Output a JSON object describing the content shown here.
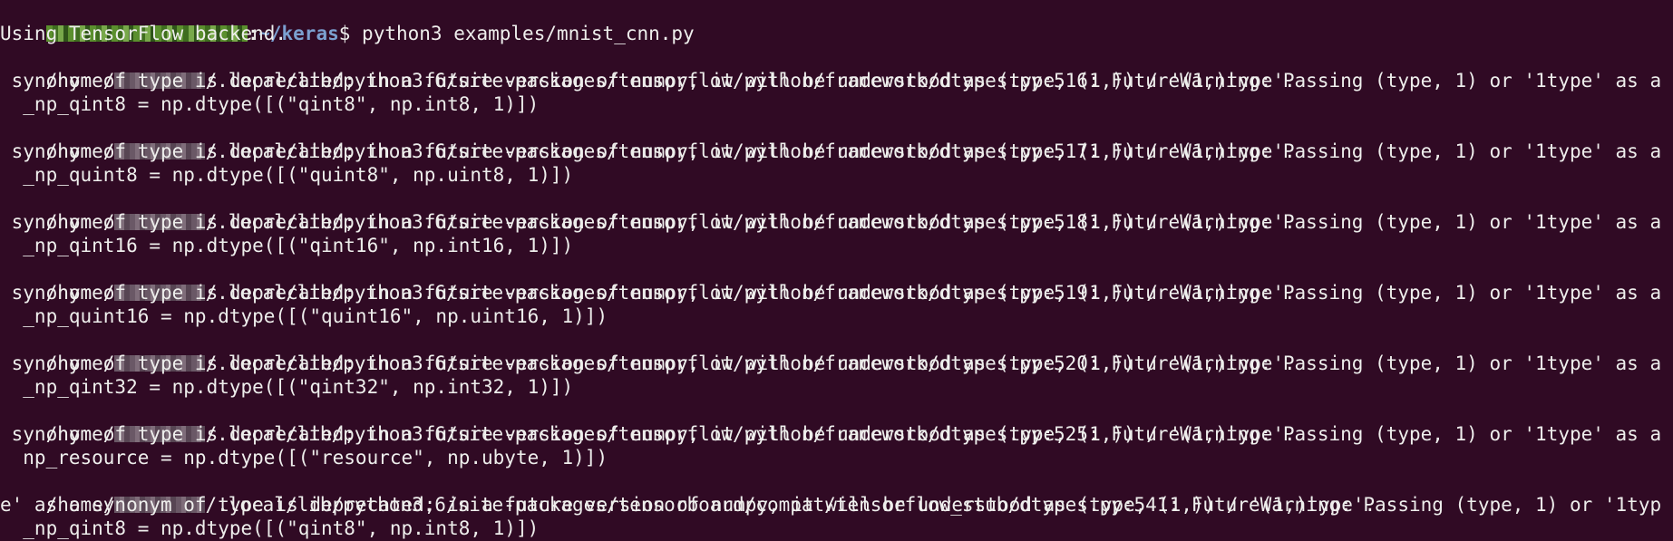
{
  "terminal": {
    "prompt": {
      "user_host_redacted": "user@host",
      "path": "~/keras",
      "symbol": "$",
      "command": " python3 examples/mnist_cnn.py"
    },
    "lines": [
      {
        "text": "Using TensorFlow backend."
      },
      {
        "home": "/home/",
        "rest": "/.local/lib/python3.6/site-packages/tensorflow/python/framework/dtypes.py:516: FutureWarning: Passing (type, 1) or '1type' as a"
      },
      {
        "text": " synonym of type is deprecated; in a future version of numpy, it will be understood as (type, (1,)) / '(1,)type'."
      },
      {
        "text": "  _np_qint8 = np.dtype([(\"qint8\", np.int8, 1)])"
      },
      {
        "home": "/home/",
        "rest": "/.local/lib/python3.6/site-packages/tensorflow/python/framework/dtypes.py:517: FutureWarning: Passing (type, 1) or '1type' as a"
      },
      {
        "text": " synonym of type is deprecated; in a future version of numpy, it will be understood as (type, (1,)) / '(1,)type'."
      },
      {
        "text": "  _np_quint8 = np.dtype([(\"quint8\", np.uint8, 1)])"
      },
      {
        "home": "/home/",
        "rest": "/.local/lib/python3.6/site-packages/tensorflow/python/framework/dtypes.py:518: FutureWarning: Passing (type, 1) or '1type' as a"
      },
      {
        "text": " synonym of type is deprecated; in a future version of numpy, it will be understood as (type, (1,)) / '(1,)type'."
      },
      {
        "text": "  _np_qint16 = np.dtype([(\"qint16\", np.int16, 1)])"
      },
      {
        "home": "/home/",
        "rest": "/.local/lib/python3.6/site-packages/tensorflow/python/framework/dtypes.py:519: FutureWarning: Passing (type, 1) or '1type' as a"
      },
      {
        "text": " synonym of type is deprecated; in a future version of numpy, it will be understood as (type, (1,)) / '(1,)type'."
      },
      {
        "text": "  _np_quint16 = np.dtype([(\"quint16\", np.uint16, 1)])"
      },
      {
        "home": "/home/",
        "rest": "/.local/lib/python3.6/site-packages/tensorflow/python/framework/dtypes.py:520: FutureWarning: Passing (type, 1) or '1type' as a"
      },
      {
        "text": " synonym of type is deprecated; in a future version of numpy, it will be understood as (type, (1,)) / '(1,)type'."
      },
      {
        "text": "  _np_qint32 = np.dtype([(\"qint32\", np.int32, 1)])"
      },
      {
        "home": "/home/",
        "rest": "/.local/lib/python3.6/site-packages/tensorflow/python/framework/dtypes.py:525: FutureWarning: Passing (type, 1) or '1type' as a"
      },
      {
        "text": " synonym of type is deprecated; in a future version of numpy, it will be understood as (type, (1,)) / '(1,)type'."
      },
      {
        "text": "  np_resource = np.dtype([(\"resource\", np.ubyte, 1)])"
      },
      {
        "home": "/home/",
        "rest": "/.local/lib/python3.6/site-packages/tensorboard/compat/tensorflow_stub/dtypes.py:541: FutureWarning: Passing (type, 1) or '1typ"
      },
      {
        "text": "e' as a synonym of type is deprecated; in a future version of numpy, it will be understood as (type, (1,)) / '(1,)type'."
      },
      {
        "text": "  _np_qint8 = np.dtype([(\"qint8\", np.int8, 1)])"
      }
    ]
  },
  "colors": {
    "background": "#300a24",
    "foreground": "#eeeeec",
    "prompt_path": "#7b9fcf"
  }
}
